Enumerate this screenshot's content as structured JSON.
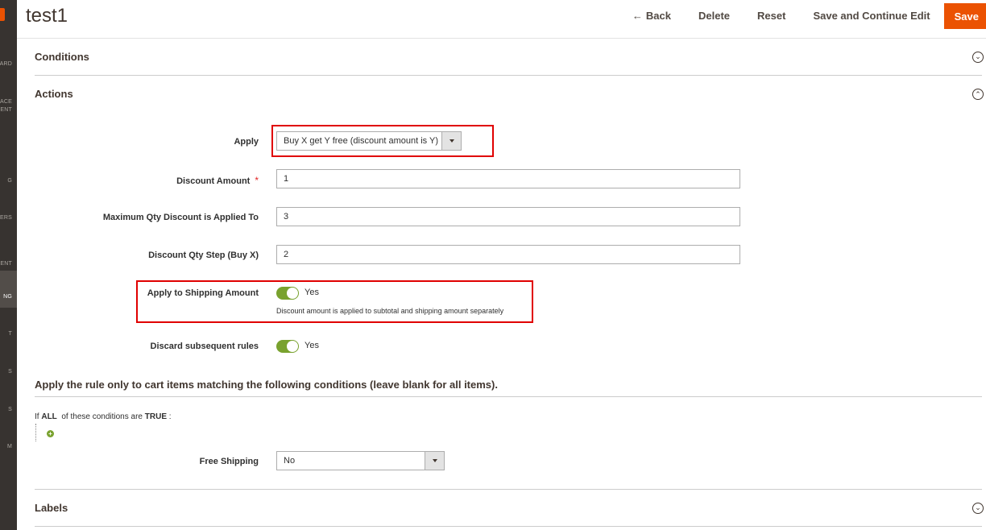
{
  "sidebar": {
    "items": [
      "ARD",
      "ACE",
      "ENT",
      "G",
      "ERS",
      "ENT",
      "NG",
      "T",
      "S",
      "S",
      "M"
    ]
  },
  "header": {
    "title": "test1",
    "back_label": "Back",
    "delete_label": "Delete",
    "reset_label": "Reset",
    "save_continue_label": "Save and Continue Edit",
    "save_label": "Save"
  },
  "sections": {
    "conditions": "Conditions",
    "actions": "Actions",
    "labels": "Labels"
  },
  "form": {
    "apply": {
      "label": "Apply",
      "value": "Buy X get Y free (discount amount is Y)"
    },
    "discount_amount": {
      "label": "Discount Amount",
      "required": "*",
      "value": "1"
    },
    "max_qty": {
      "label": "Maximum Qty Discount is Applied To",
      "value": "3"
    },
    "qty_step": {
      "label": "Discount Qty Step (Buy X)",
      "value": "2"
    },
    "apply_shipping": {
      "label": "Apply to Shipping Amount",
      "state": "Yes",
      "note": "Discount amount is applied to subtotal and shipping amount separately"
    },
    "discard_rules": {
      "label": "Discard subsequent rules",
      "state": "Yes"
    },
    "free_shipping": {
      "label": "Free Shipping",
      "value": "No"
    }
  },
  "conditions_block": {
    "heading": "Apply the rule only to cart items matching the following conditions (leave blank for all items).",
    "if_word": "If",
    "aggregator": "ALL",
    "middle_text": "of these conditions are",
    "value": "TRUE",
    "colon": ":"
  },
  "colors": {
    "accent": "#eb5202",
    "toggle_on": "#79a22e",
    "highlight": "#e00000"
  }
}
